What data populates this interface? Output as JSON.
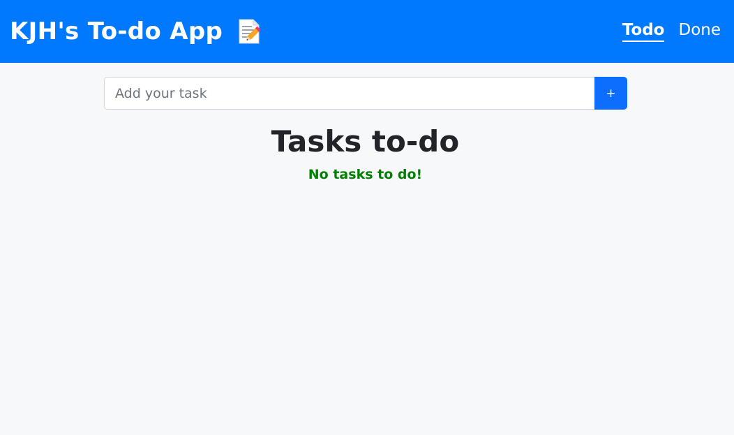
{
  "header": {
    "title": "KJH's To-do App",
    "icon": "memo-icon",
    "background_color": "#0079fe"
  },
  "nav": {
    "items": [
      {
        "label": "Todo",
        "active": true
      },
      {
        "label": "Done",
        "active": false
      }
    ]
  },
  "add_task": {
    "placeholder": "Add your task",
    "value": "",
    "button_label": "+",
    "button_color": "#0d6efd"
  },
  "main": {
    "title": "Tasks to-do",
    "empty_message": "No tasks to do!",
    "empty_message_color": "#008000"
  }
}
